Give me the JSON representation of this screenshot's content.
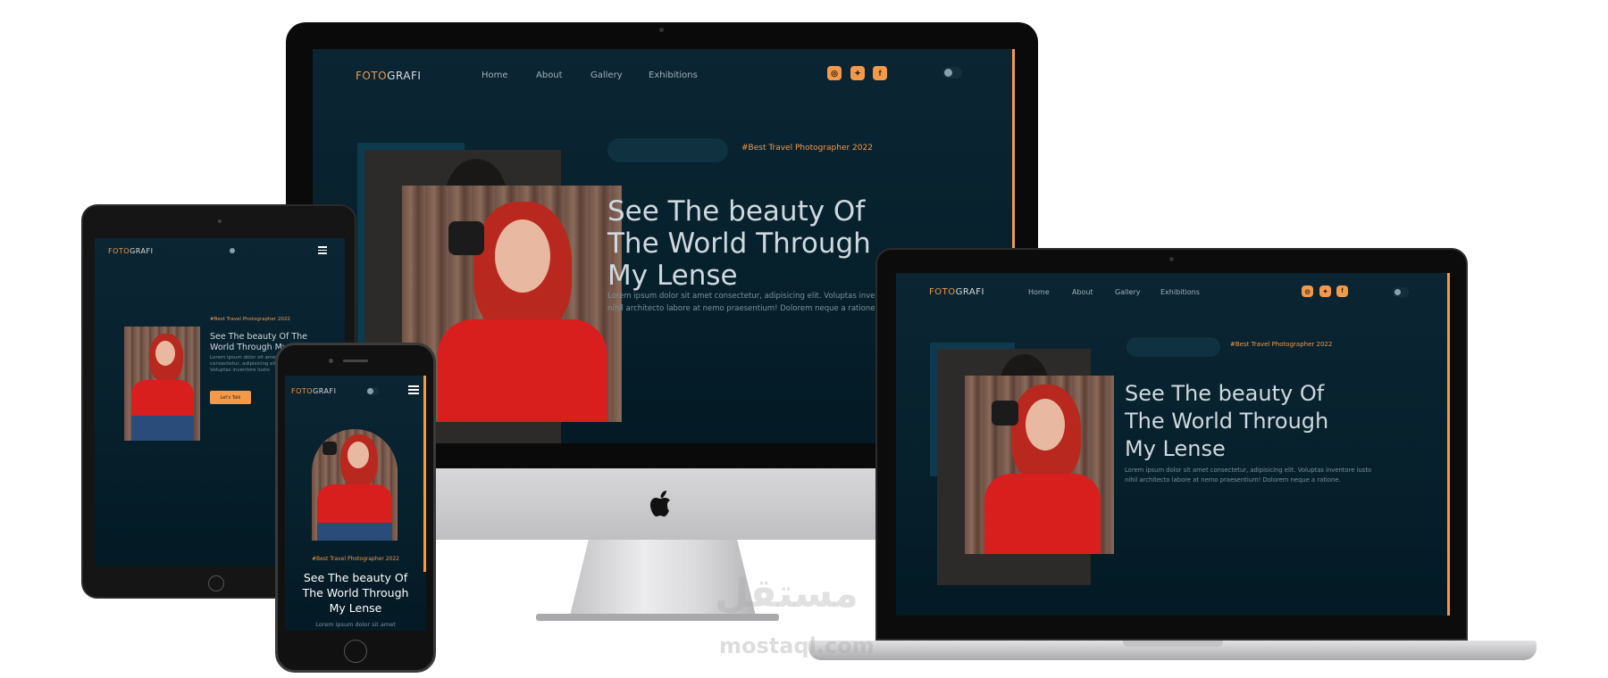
{
  "site": {
    "logo_accent": "FOTO",
    "logo_rest": "GRAFI",
    "nav": [
      "Home",
      "About",
      "Gallery",
      "Exhibitions"
    ],
    "tag": "#Best Travel Photographer 2022",
    "headline_line1": "See The beauty Of",
    "headline_line2": "The World Through",
    "headline_line3": "My Lense",
    "headline_full": "See The beauty Of The World Through My Lense",
    "lorem_line1": "Lorem ipsum dolor sit amet consectetur, adipisicing elit. Voluptas inventore iusto",
    "lorem_line2": "nihil architecto labore at nemo praesentium! Dolorem neque a ratione.",
    "phone_lorem": "Lorem ipsum dolor sit amet",
    "cta": "Let's Talk",
    "social_icons": [
      "instagram-icon",
      "twitter-icon",
      "facebook-icon"
    ]
  },
  "watermark": {
    "arabic": "مستقل",
    "latin": "mostaql.com"
  },
  "colors": {
    "accent": "#f2994a",
    "screen_bg": "#06202c",
    "headline": "#cfd9df"
  }
}
